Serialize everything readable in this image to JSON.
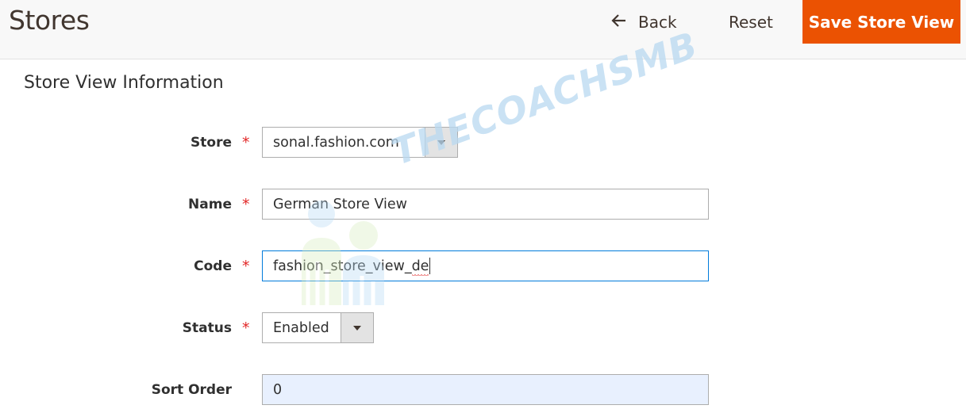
{
  "header": {
    "title": "Stores",
    "back_label": "Back",
    "reset_label": "Reset",
    "save_label": "Save Store View",
    "accent_color": "#eb5202"
  },
  "section": {
    "title": "Store View Information"
  },
  "form": {
    "store": {
      "label": "Store",
      "required": true,
      "value": "sonal.fashion.com"
    },
    "name": {
      "label": "Name",
      "required": true,
      "value": "German Store View"
    },
    "code": {
      "label": "Code",
      "required": true,
      "value_main": "fashion_store_view_",
      "value_flagged": "de"
    },
    "status": {
      "label": "Status",
      "required": true,
      "value": "Enabled"
    },
    "sort_order": {
      "label": "Sort Order",
      "required": false,
      "value": "0"
    }
  },
  "required_marker": "*",
  "watermark": {
    "text": "THECOACHSMB"
  }
}
